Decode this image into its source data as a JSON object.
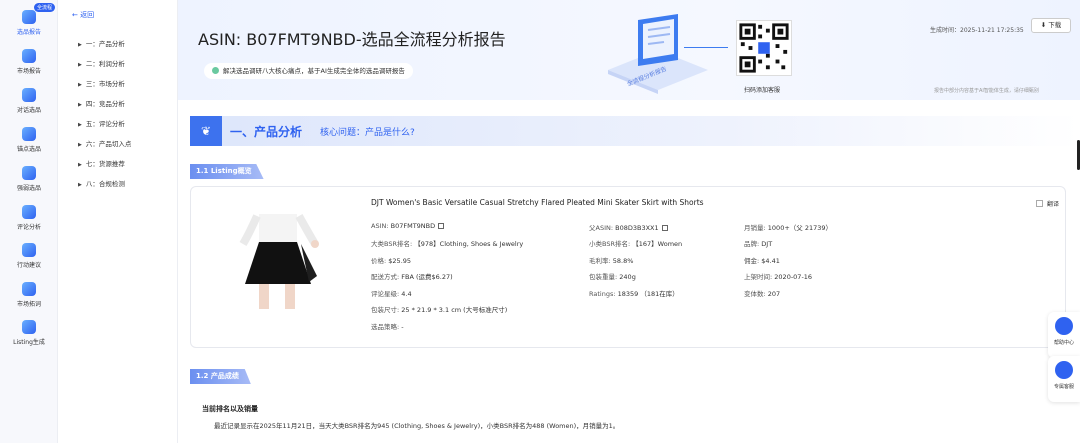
{
  "rail": {
    "badge": "全流程",
    "items": [
      {
        "label": "选品报告",
        "icon": "report-icon"
      },
      {
        "label": "市场报告",
        "icon": "market-icon"
      },
      {
        "label": "对话选品",
        "icon": "chat-icon"
      },
      {
        "label": "锚点选品",
        "icon": "anchor-icon"
      },
      {
        "label": "强弱选品",
        "icon": "strength-icon"
      },
      {
        "label": "评论分析",
        "icon": "review-icon"
      },
      {
        "label": "行动建议",
        "icon": "compass-icon"
      },
      {
        "label": "市场拓词",
        "icon": "keyword-icon"
      },
      {
        "label": "Listing生成",
        "icon": "listing-icon"
      }
    ]
  },
  "toc": {
    "back": "返回",
    "items": [
      "一：产品分析",
      "二：利润分析",
      "三：市场分析",
      "四：竞品分析",
      "五：评论分析",
      "六：产品切入点",
      "七：货源推荐",
      "八：合规检测"
    ]
  },
  "header": {
    "title": "ASIN: B07FMT9NBD-选品全流程分析报告",
    "subtitle": "解决选品调研八大核心痛点，基于AI生成完全体的选品调研报告",
    "illustration_text": "全流程分析报告",
    "qr_caption": "扫码添加客服",
    "generated": "生成时间：2025-11-21 17:25:35",
    "download": "下载",
    "disclaimer": "报告中部分内容基于AI智能体生成，请仔细甄别"
  },
  "section": {
    "title": "一、产品分析",
    "question": "核心问题：产品是什么?"
  },
  "listing": {
    "chip": "1.1 Listing概览",
    "product_title": "DJT Women's Basic Versatile Casual Stretchy Flared Pleated Mini Skater Skirt with Shorts",
    "translate": "翻译",
    "col1": [
      {
        "k": "ASIN:",
        "v": "B07FMT9NBD"
      },
      {
        "k": "大类BSR排名:",
        "v": "【978】Clothing, Shoes & Jewelry"
      },
      {
        "k": "价格:",
        "v": "$25.95"
      },
      {
        "k": "配送方式:",
        "v": "FBA (运费$6.27)"
      },
      {
        "k": "评论星级:",
        "v": "4.4"
      },
      {
        "k": "包装尺寸:",
        "v": "25 * 21.9 * 3.1 cm (大号标准尺寸)"
      },
      {
        "k": "选品策略:",
        "v": "-"
      }
    ],
    "col2": [
      {
        "k": "父ASIN:",
        "v": "B08D3B3XX1"
      },
      {
        "k": "小类BSR排名:",
        "v": "【167】Women"
      },
      {
        "k": "毛利率:",
        "v": "58.8%"
      },
      {
        "k": "包装重量:",
        "v": "240g"
      },
      {
        "k": "Ratings:",
        "v": "18359 （181在库）"
      }
    ],
    "col3": [
      {
        "k": "月销量:",
        "v": "1000+（父 21739）"
      },
      {
        "k": "品牌:",
        "v": "DJT"
      },
      {
        "k": "佣金:",
        "v": "$4.41"
      },
      {
        "k": "上架时间:",
        "v": "2020-07-16"
      },
      {
        "k": "变体数:",
        "v": "207"
      }
    ]
  },
  "performance": {
    "chip": "1.2 产品成绩",
    "heading": "当前排名以及销量",
    "text": "最近记录显示在2025年11月21日，当天大类BSR排名为945 (Clothing, Shoes & Jewelry)，小类BSR排名为488 (Women)，月销量为1。"
  },
  "float": {
    "help": "帮助中心",
    "service": "专属客服"
  },
  "colors": {
    "accent": "#2f62f0",
    "chip": "#6b8ff0",
    "hero_bg": "#eef3ff"
  }
}
